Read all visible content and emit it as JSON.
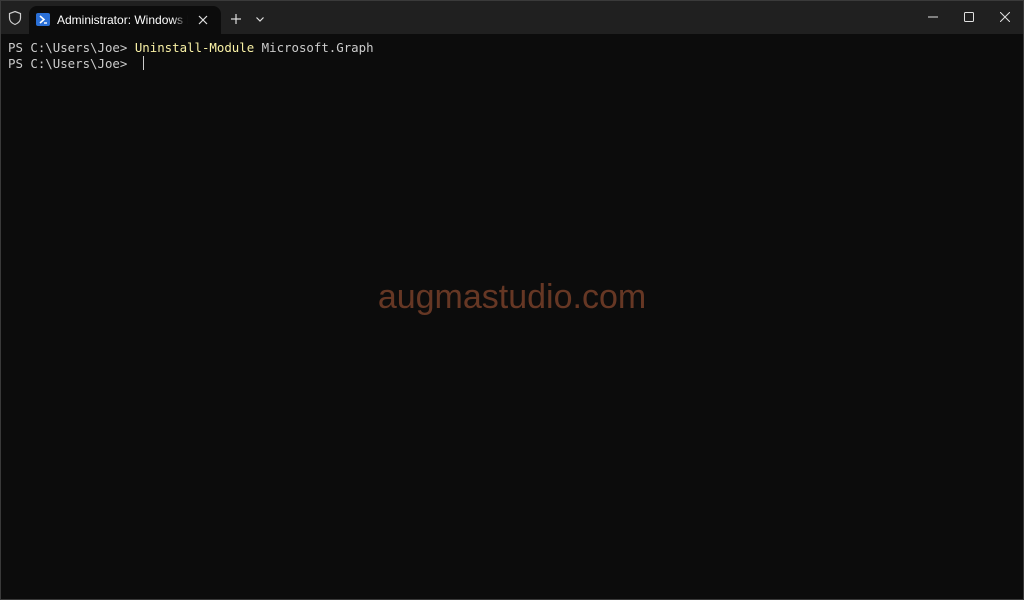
{
  "window": {
    "tab_title": "Administrator: Windows PowerShell",
    "icons": {
      "admin": "shield-icon",
      "tab": "powershell-icon",
      "close_tab": "close-icon",
      "new_tab": "plus-icon",
      "dropdown": "chevron-down-icon",
      "minimize": "minimize-icon",
      "maximize": "maximize-icon",
      "close": "close-icon"
    }
  },
  "terminal": {
    "lines": [
      {
        "prompt": "PS C:\\Users\\Joe> ",
        "command": "Uninstall-Module",
        "args": " Microsoft.Graph"
      },
      {
        "prompt": "PS C:\\Users\\Joe> "
      }
    ],
    "colors": {
      "background": "#0c0c0c",
      "text": "#cccccc",
      "command": "#f9f1a5"
    }
  },
  "watermark": "augmastudio.com"
}
